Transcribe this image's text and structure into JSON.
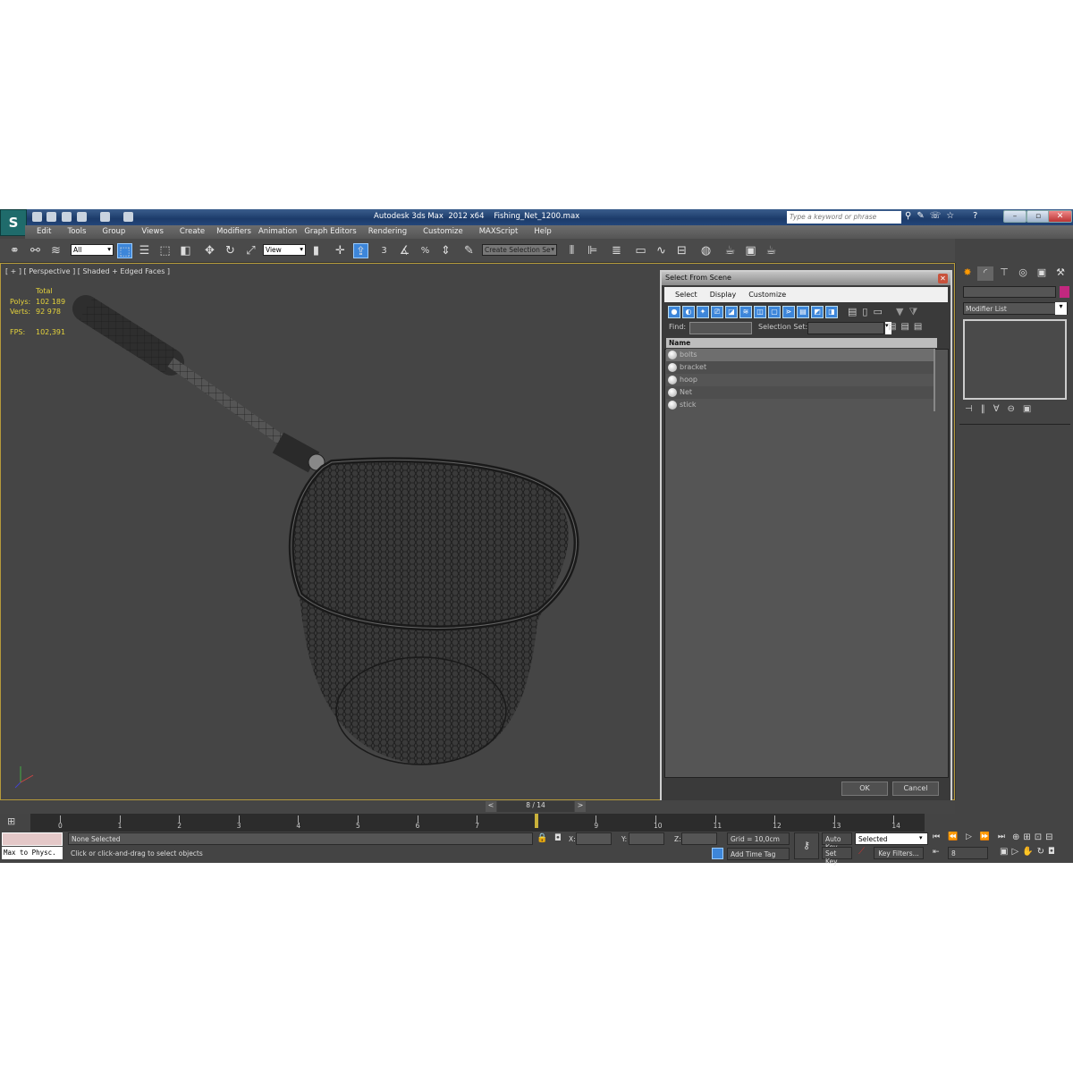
{
  "window": {
    "app_title": "Autodesk 3ds Max  2012 x64",
    "file_name": "Fishing_Net_1200.max",
    "search_placeholder": "Type a keyword or phrase"
  },
  "menu": [
    "Edit",
    "Tools",
    "Group",
    "Views",
    "Create",
    "Modifiers",
    "Animation",
    "Graph Editors",
    "Rendering",
    "Customize",
    "MAXScript",
    "Help"
  ],
  "toolbar": {
    "selection_filter": "All",
    "reference_coord": "View",
    "named_selection": "Create Selection Se",
    "snaps": [
      "3",
      "%"
    ]
  },
  "viewport": {
    "label": "[ + ] [ Perspective ] [ Shaded + Edged Faces ]",
    "stats": {
      "header": "Total",
      "polys_label": "Polys:",
      "polys": "102 189",
      "verts_label": "Verts:",
      "verts": "92 978",
      "fps_label": "FPS:",
      "fps": "102,391"
    },
    "border_color": "#b59a3b"
  },
  "command_panel": {
    "modifier_list": "Modifier List",
    "color_swatch": "#c2287f"
  },
  "dialog": {
    "title": "Select From Scene",
    "menu": [
      "Select",
      "Display",
      "Customize"
    ],
    "find_label": "Find:",
    "find_value": "",
    "selection_set_label": "Selection Set:",
    "column_name": "Name",
    "items": [
      "bolts",
      "bracket",
      "hoop",
      "Net",
      "stick"
    ],
    "ok": "OK",
    "cancel": "Cancel"
  },
  "timeline": {
    "frame_display": "8 / 14",
    "prev": "<",
    "next": ">",
    "ticks": [
      "0",
      "1",
      "2",
      "3",
      "4",
      "5",
      "6",
      "7",
      "8",
      "9",
      "10",
      "11",
      "12",
      "13",
      "14"
    ],
    "current_frame": 8
  },
  "status": {
    "script_listener": "Max to Physc.",
    "selection": "None Selected",
    "prompt": "Click or click-and-drag to select objects",
    "x_label": "X:",
    "y_label": "Y:",
    "z_label": "Z:",
    "grid": "Grid = 10,0cm",
    "add_time_tag": "Add Time Tag",
    "auto_key": "Auto Key",
    "set_key": "Set Key",
    "key_mode": "Selected",
    "key_filters": "Key Filters...",
    "frame": "8"
  }
}
